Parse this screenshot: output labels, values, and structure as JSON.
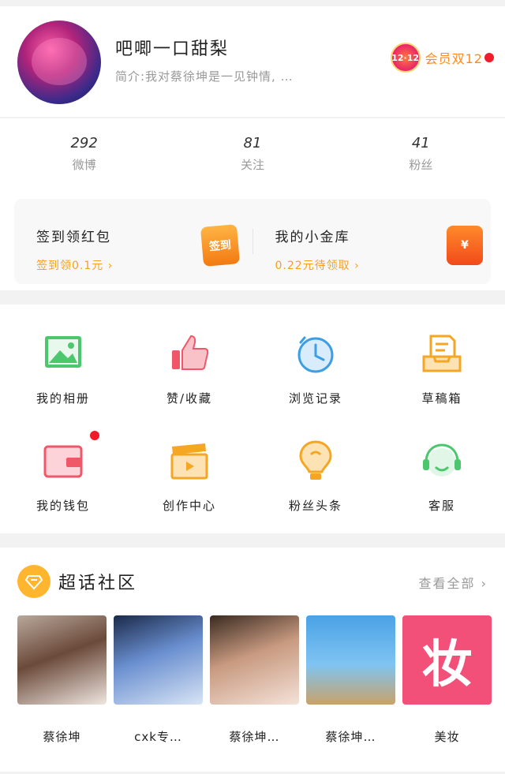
{
  "profile": {
    "username": "吧唧一口甜梨",
    "bio": "简介:我对蔡徐坤是一见钟情,  …",
    "vip_badge": "12·12",
    "vip_label": "会员双12"
  },
  "stats": [
    {
      "value": "292",
      "label": "微博"
    },
    {
      "value": "81",
      "label": "关注"
    },
    {
      "value": "41",
      "label": "粉丝"
    }
  ],
  "rewards": [
    {
      "title": "签到领红包",
      "subtitle": "签到领0.1元 ›",
      "icon": "签到"
    },
    {
      "title": "我的小金库",
      "subtitle": "0.22元待领取 ›",
      "icon": "¥"
    }
  ],
  "menu": [
    {
      "label": "我的相册",
      "icon": "photo-icon",
      "color": "#4cc76e"
    },
    {
      "label": "赞/收藏",
      "icon": "thumbs-up-icon",
      "color": "#f0586a"
    },
    {
      "label": "浏览记录",
      "icon": "clock-icon",
      "color": "#3b9ee6"
    },
    {
      "label": "草稿箱",
      "icon": "draft-box-icon",
      "color": "#f5a623"
    },
    {
      "label": "我的钱包",
      "icon": "wallet-icon",
      "color": "#f0586a"
    },
    {
      "label": "创作中心",
      "icon": "clapperboard-icon",
      "color": "#f5a623"
    },
    {
      "label": "粉丝头条",
      "icon": "lightbulb-icon",
      "color": "#f5a623"
    },
    {
      "label": "客服",
      "icon": "headset-icon",
      "color": "#4cc76e"
    }
  ],
  "community": {
    "title": "超话社区",
    "view_all": "查看全部",
    "topics": [
      {
        "name": "蔡徐坤"
      },
      {
        "name": "cxk专…"
      },
      {
        "name": "蔡徐坤…"
      },
      {
        "name": "蔡徐坤…"
      },
      {
        "name": "美妆",
        "image_text": "妆"
      }
    ]
  }
}
